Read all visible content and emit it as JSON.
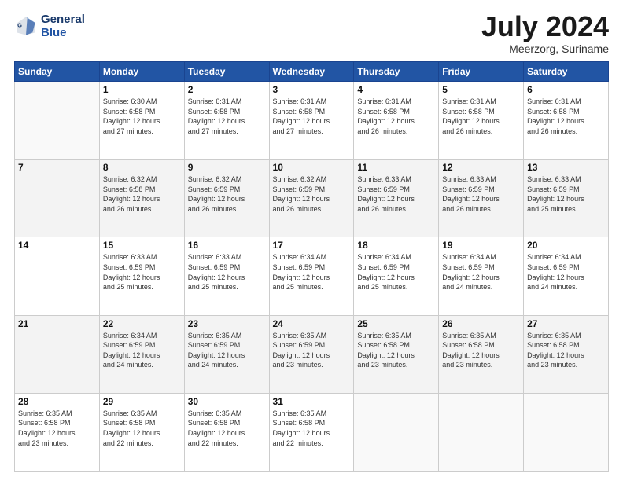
{
  "header": {
    "logo_line1": "General",
    "logo_line2": "Blue",
    "month_title": "July 2024",
    "location": "Meerzorg, Suriname"
  },
  "days_of_week": [
    "Sunday",
    "Monday",
    "Tuesday",
    "Wednesday",
    "Thursday",
    "Friday",
    "Saturday"
  ],
  "weeks": [
    [
      {
        "day": "",
        "info": ""
      },
      {
        "day": "1",
        "info": "Sunrise: 6:30 AM\nSunset: 6:58 PM\nDaylight: 12 hours\nand 27 minutes."
      },
      {
        "day": "2",
        "info": "Sunrise: 6:31 AM\nSunset: 6:58 PM\nDaylight: 12 hours\nand 27 minutes."
      },
      {
        "day": "3",
        "info": "Sunrise: 6:31 AM\nSunset: 6:58 PM\nDaylight: 12 hours\nand 27 minutes."
      },
      {
        "day": "4",
        "info": "Sunrise: 6:31 AM\nSunset: 6:58 PM\nDaylight: 12 hours\nand 26 minutes."
      },
      {
        "day": "5",
        "info": "Sunrise: 6:31 AM\nSunset: 6:58 PM\nDaylight: 12 hours\nand 26 minutes."
      },
      {
        "day": "6",
        "info": "Sunrise: 6:31 AM\nSunset: 6:58 PM\nDaylight: 12 hours\nand 26 minutes."
      }
    ],
    [
      {
        "day": "7",
        "info": ""
      },
      {
        "day": "8",
        "info": "Sunrise: 6:32 AM\nSunset: 6:58 PM\nDaylight: 12 hours\nand 26 minutes."
      },
      {
        "day": "9",
        "info": "Sunrise: 6:32 AM\nSunset: 6:59 PM\nDaylight: 12 hours\nand 26 minutes."
      },
      {
        "day": "10",
        "info": "Sunrise: 6:32 AM\nSunset: 6:59 PM\nDaylight: 12 hours\nand 26 minutes."
      },
      {
        "day": "11",
        "info": "Sunrise: 6:33 AM\nSunset: 6:59 PM\nDaylight: 12 hours\nand 26 minutes."
      },
      {
        "day": "12",
        "info": "Sunrise: 6:33 AM\nSunset: 6:59 PM\nDaylight: 12 hours\nand 26 minutes."
      },
      {
        "day": "13",
        "info": "Sunrise: 6:33 AM\nSunset: 6:59 PM\nDaylight: 12 hours\nand 25 minutes."
      }
    ],
    [
      {
        "day": "14",
        "info": ""
      },
      {
        "day": "15",
        "info": "Sunrise: 6:33 AM\nSunset: 6:59 PM\nDaylight: 12 hours\nand 25 minutes."
      },
      {
        "day": "16",
        "info": "Sunrise: 6:33 AM\nSunset: 6:59 PM\nDaylight: 12 hours\nand 25 minutes."
      },
      {
        "day": "17",
        "info": "Sunrise: 6:34 AM\nSunset: 6:59 PM\nDaylight: 12 hours\nand 25 minutes."
      },
      {
        "day": "18",
        "info": "Sunrise: 6:34 AM\nSunset: 6:59 PM\nDaylight: 12 hours\nand 25 minutes."
      },
      {
        "day": "19",
        "info": "Sunrise: 6:34 AM\nSunset: 6:59 PM\nDaylight: 12 hours\nand 24 minutes."
      },
      {
        "day": "20",
        "info": "Sunrise: 6:34 AM\nSunset: 6:59 PM\nDaylight: 12 hours\nand 24 minutes."
      }
    ],
    [
      {
        "day": "21",
        "info": ""
      },
      {
        "day": "22",
        "info": "Sunrise: 6:34 AM\nSunset: 6:59 PM\nDaylight: 12 hours\nand 24 minutes."
      },
      {
        "day": "23",
        "info": "Sunrise: 6:35 AM\nSunset: 6:59 PM\nDaylight: 12 hours\nand 24 minutes."
      },
      {
        "day": "24",
        "info": "Sunrise: 6:35 AM\nSunset: 6:59 PM\nDaylight: 12 hours\nand 23 minutes."
      },
      {
        "day": "25",
        "info": "Sunrise: 6:35 AM\nSunset: 6:58 PM\nDaylight: 12 hours\nand 23 minutes."
      },
      {
        "day": "26",
        "info": "Sunrise: 6:35 AM\nSunset: 6:58 PM\nDaylight: 12 hours\nand 23 minutes."
      },
      {
        "day": "27",
        "info": "Sunrise: 6:35 AM\nSunset: 6:58 PM\nDaylight: 12 hours\nand 23 minutes."
      }
    ],
    [
      {
        "day": "28",
        "info": "Sunrise: 6:35 AM\nSunset: 6:58 PM\nDaylight: 12 hours\nand 23 minutes."
      },
      {
        "day": "29",
        "info": "Sunrise: 6:35 AM\nSunset: 6:58 PM\nDaylight: 12 hours\nand 22 minutes."
      },
      {
        "day": "30",
        "info": "Sunrise: 6:35 AM\nSunset: 6:58 PM\nDaylight: 12 hours\nand 22 minutes."
      },
      {
        "day": "31",
        "info": "Sunrise: 6:35 AM\nSunset: 6:58 PM\nDaylight: 12 hours\nand 22 minutes."
      },
      {
        "day": "",
        "info": ""
      },
      {
        "day": "",
        "info": ""
      },
      {
        "day": "",
        "info": ""
      }
    ]
  ]
}
